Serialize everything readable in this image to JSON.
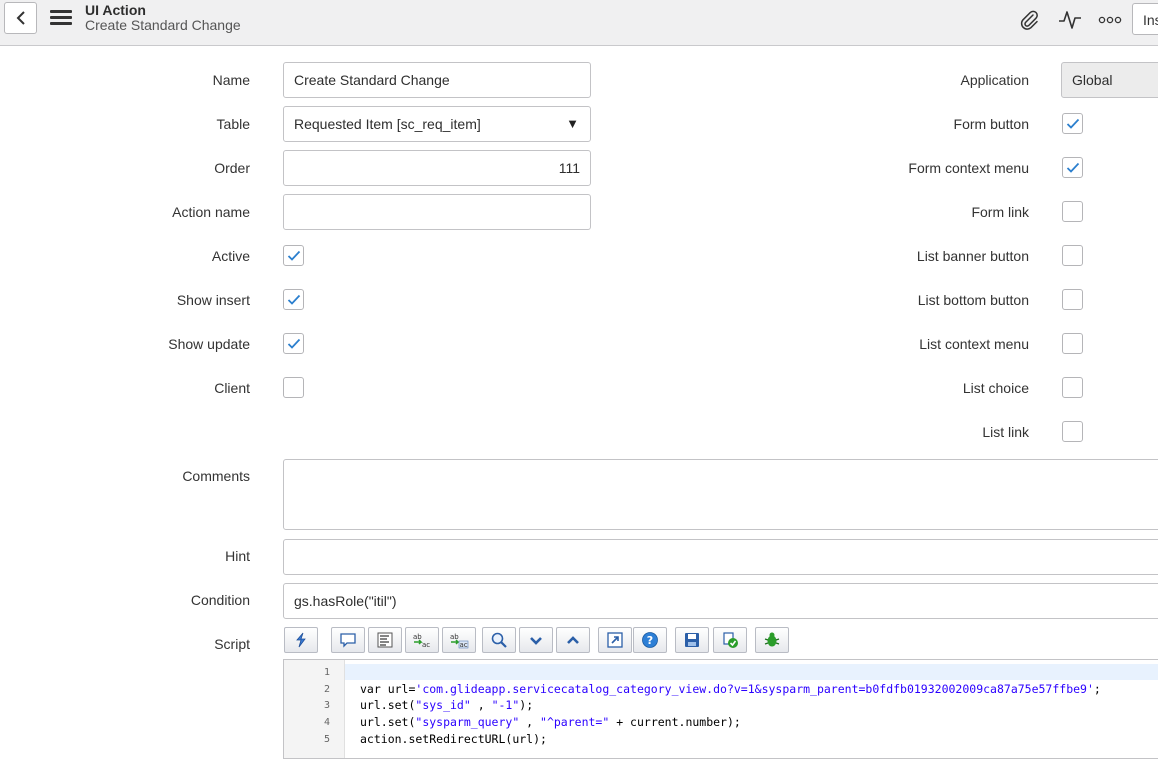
{
  "header": {
    "title": "UI Action",
    "subtitle": "Create Standard Change",
    "insert_button_label": "Ins",
    "icons": [
      "chevron-left-icon",
      "hamburger-icon",
      "paperclip-icon",
      "activity-icon",
      "more-options-icon"
    ]
  },
  "form": {
    "name": {
      "label": "Name",
      "value": "Create Standard Change"
    },
    "table": {
      "label": "Table",
      "value": "Requested Item [sc_req_item]"
    },
    "order": {
      "label": "Order",
      "value": "111"
    },
    "action_name": {
      "label": "Action name",
      "value": ""
    },
    "active": {
      "label": "Active",
      "checked": true
    },
    "show_insert": {
      "label": "Show insert",
      "checked": true
    },
    "show_update": {
      "label": "Show update",
      "checked": true
    },
    "client": {
      "label": "Client",
      "checked": false
    },
    "application": {
      "label": "Application",
      "value": "Global"
    },
    "form_button": {
      "label": "Form button",
      "checked": true
    },
    "form_context_menu": {
      "label": "Form context menu",
      "checked": true
    },
    "form_link": {
      "label": "Form link",
      "checked": false
    },
    "list_banner_button": {
      "label": "List banner button",
      "checked": false
    },
    "list_bottom_button": {
      "label": "List bottom button",
      "checked": false
    },
    "list_context_menu": {
      "label": "List context menu",
      "checked": false
    },
    "list_choice": {
      "label": "List choice",
      "checked": false
    },
    "list_link": {
      "label": "List link",
      "checked": false
    },
    "comments": {
      "label": "Comments",
      "value": ""
    },
    "hint": {
      "label": "Hint",
      "value": ""
    },
    "condition": {
      "label": "Condition",
      "value": "gs.hasRole(\"itil\")"
    },
    "script": {
      "label": "Script"
    }
  },
  "script_toolbar": {
    "buttons": [
      "format-code-icon",
      "comment-icon",
      "text-block-icon",
      "replace-icon",
      "replace-all-icon",
      "search-icon",
      "fold-down-icon",
      "fold-up-icon",
      "fullscreen-icon",
      "help-icon",
      "save-icon",
      "check-syntax-icon",
      "debug-icon"
    ]
  },
  "script_editor": {
    "lines": [
      {
        "num": "1",
        "parts": []
      },
      {
        "num": "2",
        "parts": [
          {
            "text": "var url=",
            "kind": "plain"
          },
          {
            "text": "'com.glideapp.servicecatalog_category_view.do?v=1&sysparm_parent=b0fdfb01932002009ca87a75e57ffbe9'",
            "kind": "str"
          },
          {
            "text": ";",
            "kind": "plain"
          }
        ]
      },
      {
        "num": "3",
        "parts": [
          {
            "text": "url.set(",
            "kind": "plain"
          },
          {
            "text": "\"sys_id\"",
            "kind": "str"
          },
          {
            "text": " , ",
            "kind": "plain"
          },
          {
            "text": "\"-1\"",
            "kind": "str"
          },
          {
            "text": ");",
            "kind": "plain"
          }
        ]
      },
      {
        "num": "4",
        "parts": [
          {
            "text": "url.set(",
            "kind": "plain"
          },
          {
            "text": "\"sysparm_query\"",
            "kind": "str"
          },
          {
            "text": " , ",
            "kind": "plain"
          },
          {
            "text": "\"^parent=\"",
            "kind": "str"
          },
          {
            "text": " + current.number);",
            "kind": "plain"
          }
        ]
      },
      {
        "num": "5",
        "parts": [
          {
            "text": "action.setRedirectURL(url);",
            "kind": "plain"
          }
        ]
      }
    ]
  },
  "colors": {
    "accent_check": "#2b7fce",
    "header_bg": "#f0f0f1",
    "code_string": "#2a00ff"
  }
}
